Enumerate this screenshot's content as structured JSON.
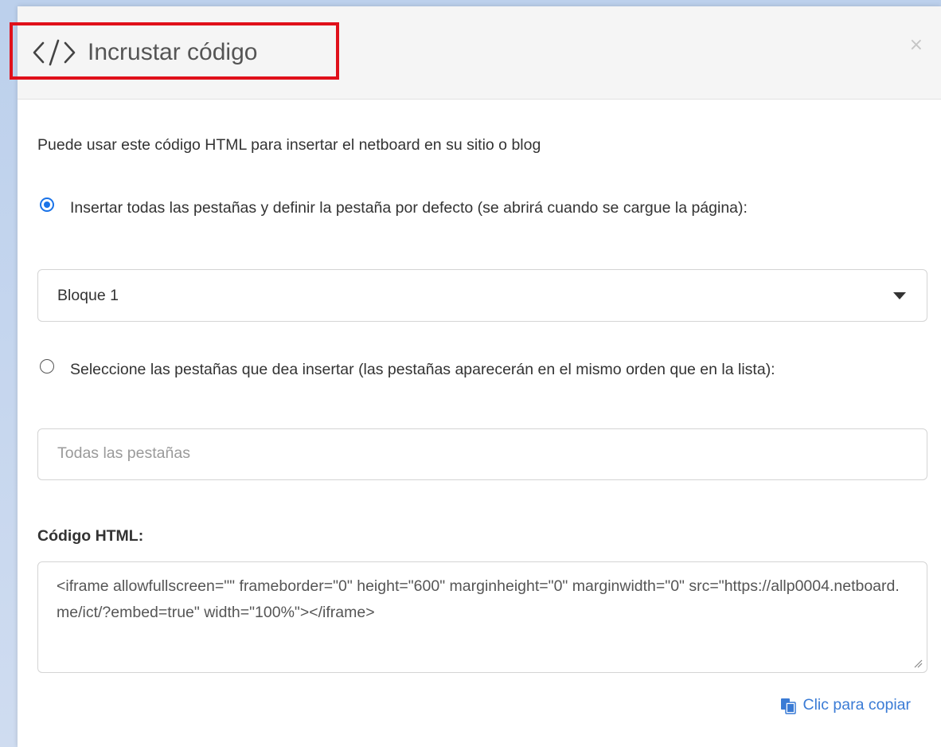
{
  "modal": {
    "title": "Incrustar código",
    "close_glyph": "×",
    "icon_name": "code-icon"
  },
  "content": {
    "intro": "Puede usar este código HTML para insertar el netboard en su sitio o blog",
    "option1": {
      "label": "Insertar todas las pestañas y definir la pestaña por defecto (se abrirá cuando se cargue la página):",
      "selected": true
    },
    "select": {
      "value": "Bloque 1"
    },
    "option2": {
      "label": "Seleccione las pestañas que dea insertar (las pestañas aparecerán en el mismo orden que en la lista):",
      "selected": false
    },
    "tabs_input": {
      "placeholder": "Todas las pestañas",
      "value": ""
    },
    "code_label": "Código HTML:",
    "code_value": "<iframe allowfullscreen=\"\" frameborder=\"0\" height=\"600\" marginheight=\"0\" marginwidth=\"0\" src=\"https://allp0004.netboard.me/ict/?embed=true\" width=\"100%\"></iframe>",
    "copy_label": "Clic para copiar"
  },
  "colors": {
    "highlight": "#e0101a",
    "accent": "#3a7bd5",
    "radio": "#1a73e8"
  }
}
